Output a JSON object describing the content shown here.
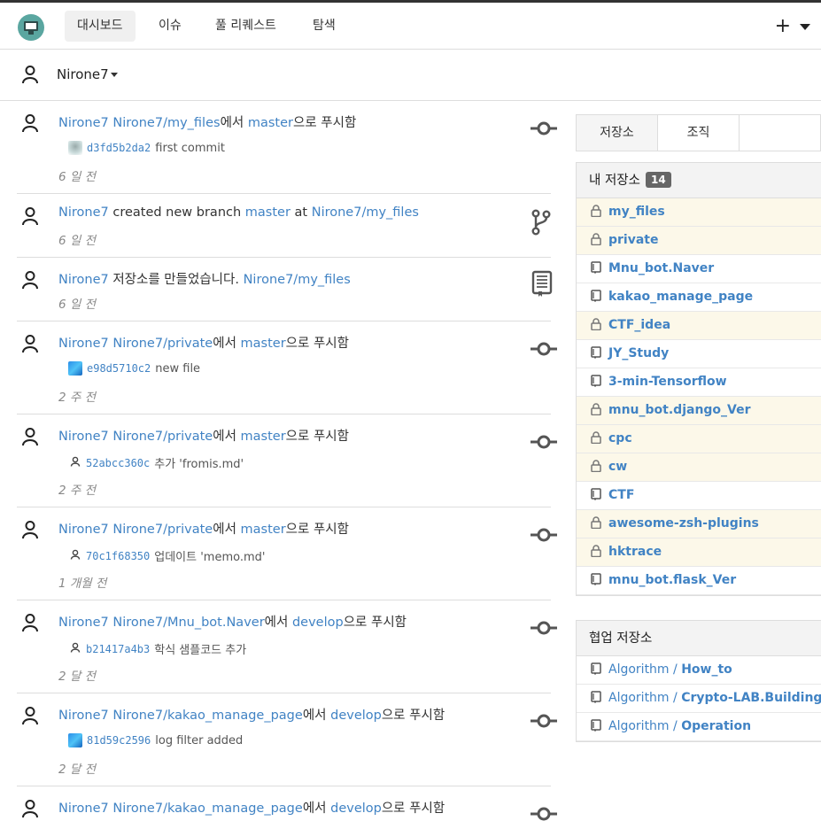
{
  "nav": {
    "items": [
      "대시보드",
      "이슈",
      "풀 리퀘스트",
      "탐색"
    ],
    "plus": "+"
  },
  "context_user": "Nirone7",
  "feed": [
    {
      "user": "Nirone7",
      "repo": "Nirone7/my_files",
      "mid1": "에서 ",
      "branch": "master",
      "tail": "으로 푸시함",
      "avatar": "grey",
      "sha": "d3fd5b2da2",
      "msg": "first commit",
      "time": "6 일 전",
      "icon": "commit"
    },
    {
      "user": "Nirone7",
      "pre": " created new branch ",
      "branch": "master",
      "mid1": " at ",
      "repo": "Nirone7/my_files",
      "time": "6 일 전",
      "icon": "branch"
    },
    {
      "user": "Nirone7",
      "pre": " 저장소를 만들었습니다. ",
      "repo": "Nirone7/my_files",
      "time": "6 일 전",
      "icon": "book"
    },
    {
      "user": "Nirone7",
      "repo": "Nirone7/private",
      "mid1": "에서 ",
      "branch": "master",
      "tail": "으로 푸시함",
      "avatar": "blue",
      "sha": "e98d5710c2",
      "msg": "new file",
      "time": "2 주 전",
      "icon": "commit"
    },
    {
      "user": "Nirone7",
      "repo": "Nirone7/private",
      "mid1": "에서 ",
      "branch": "master",
      "tail": "으로 푸시함",
      "avatar": "person",
      "sha": "52abcc360c",
      "msg": "추가 'fromis.md'",
      "time": "2 주 전",
      "icon": "commit"
    },
    {
      "user": "Nirone7",
      "repo": "Nirone7/private",
      "mid1": "에서 ",
      "branch": "master",
      "tail": "으로 푸시함",
      "avatar": "person",
      "sha": "70c1f68350",
      "msg": "업데이트 'memo.md'",
      "time": "1 개월 전",
      "icon": "commit"
    },
    {
      "user": "Nirone7",
      "repo": "Nirone7/Mnu_bot.Naver",
      "mid1": "에서 ",
      "branch": "develop",
      "tail": "으로 푸시함",
      "avatar": "person",
      "sha": "b21417a4b3",
      "msg": "학식 샘플코드 추가",
      "time": "2 달 전",
      "icon": "commit"
    },
    {
      "user": "Nirone7",
      "repo": "Nirone7/kakao_manage_page",
      "mid1": "에서 ",
      "branch": "develop",
      "tail": "으로 푸시함",
      "avatar": "blue",
      "sha": "81d59c2596",
      "msg": "log filter added",
      "time": "2 달 전",
      "icon": "commit"
    },
    {
      "user": "Nirone7",
      "repo": "Nirone7/kakao_manage_page",
      "mid1": "에서 ",
      "branch": "develop",
      "tail": "으로 푸시함",
      "icon": "commit"
    }
  ],
  "sidebar": {
    "tabs": [
      "저장소",
      "조직",
      ""
    ],
    "my_repos_title": "내 저장소",
    "my_repos_count": "14",
    "my_repos": [
      {
        "name": "my_files",
        "private": true
      },
      {
        "name": "private",
        "private": true
      },
      {
        "name": "Mnu_bot.Naver",
        "private": false
      },
      {
        "name": "kakao_manage_page",
        "private": false
      },
      {
        "name": "CTF_idea",
        "private": true
      },
      {
        "name": "JY_Study",
        "private": false
      },
      {
        "name": "3-min-Tensorflow",
        "private": false
      },
      {
        "name": "mnu_bot.django_Ver",
        "private": true
      },
      {
        "name": "cpc",
        "private": true
      },
      {
        "name": "cw",
        "private": true
      },
      {
        "name": "CTF",
        "private": false
      },
      {
        "name": "awesome-zsh-plugins",
        "private": true
      },
      {
        "name": "hktrace",
        "private": true
      },
      {
        "name": "mnu_bot.flask_Ver",
        "private": false
      }
    ],
    "collab_title": "협업 저장소",
    "collab_repos": [
      {
        "owner": "Algorithm",
        "sep": " / ",
        "name": "How_to"
      },
      {
        "owner": "Algorithm",
        "sep": " / ",
        "name": "Crypto-LAB.Building"
      },
      {
        "owner": "Algorithm",
        "sep": " / ",
        "name": "Operation"
      }
    ]
  }
}
